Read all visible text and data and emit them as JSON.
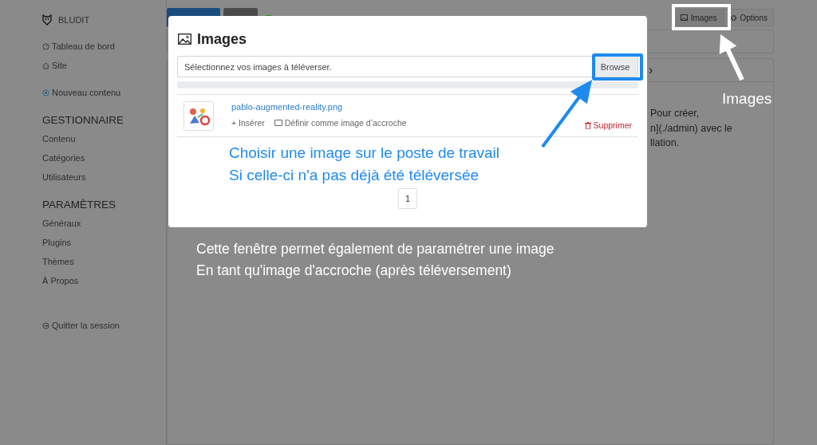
{
  "sidebar": {
    "brand": "BLUDIT",
    "top_links": [
      {
        "label": "Tableau de bord"
      },
      {
        "label": "Site"
      }
    ],
    "new_content": "Nouveau contenu",
    "sections": [
      {
        "heading": "GESTIONNAIRE",
        "items": [
          "Contenu",
          "Catégories",
          "Utilisateurs"
        ]
      },
      {
        "heading": "PARAMÈTRES",
        "items": [
          "Généraux",
          "Plugins",
          "Thèmes",
          "À Propos"
        ]
      }
    ],
    "logout": "Quitter la session"
  },
  "toolbar": {
    "buttons": [
      {
        "label": "Images"
      },
      {
        "label": "Options"
      }
    ]
  },
  "editor": {
    "tab_chevron": "›",
    "lines": [
      "Pour créer,",
      "n](./admin) avec le",
      "llation."
    ]
  },
  "modal": {
    "title": "Images",
    "upload": {
      "placeholder": "Sélectionnez vos images à téléverser.",
      "button": "Browse"
    },
    "progress": {
      "level": 0
    },
    "files": [
      {
        "name": "pablo-augmented-reality.png",
        "insert": "+ Insérer",
        "cover": "Définir comme image d’accroche",
        "delete": "Supprimer"
      }
    ],
    "pages": [
      "1"
    ]
  },
  "annotations": {
    "images_label": "Images",
    "upload_hint": [
      "Choisir une image sur le poste de travail",
      "Si celle-ci n'a pas déjà été téléversée"
    ],
    "modal_hint": [
      "Cette fenêtre permet également de paramétrer une image",
      "En tant qu'image d'accroche (après téléversement)"
    ]
  }
}
